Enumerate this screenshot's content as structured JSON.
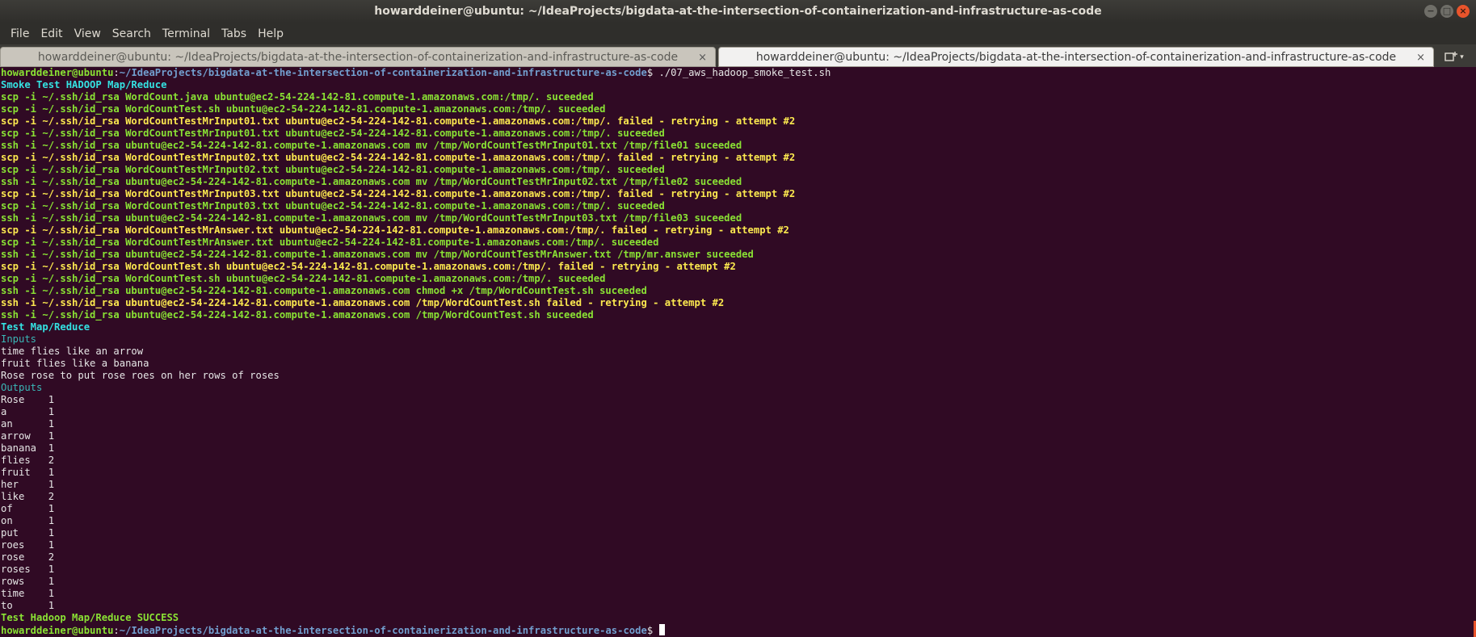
{
  "window": {
    "title": "howarddeiner@ubuntu: ~/IdeaProjects/bigdata-at-the-intersection-of-containerization-and-infrastructure-as-code",
    "buttons": {
      "minimize": "−",
      "maximize": "□",
      "close": "×"
    }
  },
  "menubar": {
    "items": [
      "File",
      "Edit",
      "View",
      "Search",
      "Terminal",
      "Tabs",
      "Help"
    ]
  },
  "tabs": [
    {
      "label": "howarddeiner@ubuntu: ~/IdeaProjects/bigdata-at-the-intersection-of-containerization-and-infrastructure-as-code",
      "close": "×",
      "active": false
    },
    {
      "label": "howarddeiner@ubuntu: ~/IdeaProjects/bigdata-at-the-intersection-of-containerization-and-infrastructure-as-code",
      "close": "×",
      "active": true
    }
  ],
  "new_tab_icon": "new-tab-icon",
  "terminal": {
    "prompt_user": "howarddeiner@ubuntu",
    "prompt_path": "~/IdeaProjects/bigdata-at-the-intersection-of-containerization-and-infrastructure-as-code",
    "command": " ./07_aws_hadoop_smoke_test.sh",
    "lines": [
      {
        "text": "Smoke Test HADOOP Map/Reduce",
        "color": "cyan"
      },
      {
        "text": "scp -i ~/.ssh/id_rsa WordCount.java ubuntu@ec2-54-224-142-81.compute-1.amazonaws.com:/tmp/. suceeded",
        "color": "green"
      },
      {
        "text": "scp -i ~/.ssh/id_rsa WordCountTest.sh ubuntu@ec2-54-224-142-81.compute-1.amazonaws.com:/tmp/. suceeded",
        "color": "green"
      },
      {
        "text": "scp -i ~/.ssh/id_rsa WordCountTestMrInput01.txt ubuntu@ec2-54-224-142-81.compute-1.amazonaws.com:/tmp/. failed - retrying - attempt #2",
        "color": "yellow"
      },
      {
        "text": "scp -i ~/.ssh/id_rsa WordCountTestMrInput01.txt ubuntu@ec2-54-224-142-81.compute-1.amazonaws.com:/tmp/. suceeded",
        "color": "green"
      },
      {
        "text": "ssh -i ~/.ssh/id_rsa ubuntu@ec2-54-224-142-81.compute-1.amazonaws.com mv /tmp/WordCountTestMrInput01.txt /tmp/file01 suceeded",
        "color": "green"
      },
      {
        "text": "scp -i ~/.ssh/id_rsa WordCountTestMrInput02.txt ubuntu@ec2-54-224-142-81.compute-1.amazonaws.com:/tmp/. failed - retrying - attempt #2",
        "color": "yellow"
      },
      {
        "text": "scp -i ~/.ssh/id_rsa WordCountTestMrInput02.txt ubuntu@ec2-54-224-142-81.compute-1.amazonaws.com:/tmp/. suceeded",
        "color": "green"
      },
      {
        "text": "ssh -i ~/.ssh/id_rsa ubuntu@ec2-54-224-142-81.compute-1.amazonaws.com mv /tmp/WordCountTestMrInput02.txt /tmp/file02 suceeded",
        "color": "green"
      },
      {
        "text": "scp -i ~/.ssh/id_rsa WordCountTestMrInput03.txt ubuntu@ec2-54-224-142-81.compute-1.amazonaws.com:/tmp/. failed - retrying - attempt #2",
        "color": "yellow"
      },
      {
        "text": "scp -i ~/.ssh/id_rsa WordCountTestMrInput03.txt ubuntu@ec2-54-224-142-81.compute-1.amazonaws.com:/tmp/. suceeded",
        "color": "green"
      },
      {
        "text": "ssh -i ~/.ssh/id_rsa ubuntu@ec2-54-224-142-81.compute-1.amazonaws.com mv /tmp/WordCountTestMrInput03.txt /tmp/file03 suceeded",
        "color": "green"
      },
      {
        "text": "scp -i ~/.ssh/id_rsa WordCountTestMrAnswer.txt ubuntu@ec2-54-224-142-81.compute-1.amazonaws.com:/tmp/. failed - retrying - attempt #2",
        "color": "yellow"
      },
      {
        "text": "scp -i ~/.ssh/id_rsa WordCountTestMrAnswer.txt ubuntu@ec2-54-224-142-81.compute-1.amazonaws.com:/tmp/. suceeded",
        "color": "green"
      },
      {
        "text": "ssh -i ~/.ssh/id_rsa ubuntu@ec2-54-224-142-81.compute-1.amazonaws.com mv /tmp/WordCountTestMrAnswer.txt /tmp/mr.answer suceeded",
        "color": "green"
      },
      {
        "text": "scp -i ~/.ssh/id_rsa WordCountTest.sh ubuntu@ec2-54-224-142-81.compute-1.amazonaws.com:/tmp/. failed - retrying - attempt #2",
        "color": "yellow"
      },
      {
        "text": "scp -i ~/.ssh/id_rsa WordCountTest.sh ubuntu@ec2-54-224-142-81.compute-1.amazonaws.com:/tmp/. suceeded",
        "color": "green"
      },
      {
        "text": "ssh -i ~/.ssh/id_rsa ubuntu@ec2-54-224-142-81.compute-1.amazonaws.com chmod +x /tmp/WordCountTest.sh suceeded",
        "color": "green"
      },
      {
        "text": "ssh -i ~/.ssh/id_rsa ubuntu@ec2-54-224-142-81.compute-1.amazonaws.com /tmp/WordCountTest.sh failed - retrying - attempt #2",
        "color": "yellow"
      },
      {
        "text": "ssh -i ~/.ssh/id_rsa ubuntu@ec2-54-224-142-81.compute-1.amazonaws.com /tmp/WordCountTest.sh suceeded",
        "color": "green"
      },
      {
        "text": "Test Map/Reduce",
        "color": "cyan"
      },
      {
        "text": "Inputs",
        "color": "teal"
      },
      {
        "text": "time flies like an arrow",
        "color": "white"
      },
      {
        "text": "fruit flies like a banana",
        "color": "white"
      },
      {
        "text": "Rose rose to put rose roes on her rows of roses",
        "color": "white"
      },
      {
        "text": "Outputs",
        "color": "teal"
      },
      {
        "text": "Rose    1",
        "color": "white"
      },
      {
        "text": "a       1",
        "color": "white"
      },
      {
        "text": "an      1",
        "color": "white"
      },
      {
        "text": "arrow   1",
        "color": "white"
      },
      {
        "text": "banana  1",
        "color": "white"
      },
      {
        "text": "flies   2",
        "color": "white"
      },
      {
        "text": "fruit   1",
        "color": "white"
      },
      {
        "text": "her     1",
        "color": "white"
      },
      {
        "text": "like    2",
        "color": "white"
      },
      {
        "text": "of      1",
        "color": "white"
      },
      {
        "text": "on      1",
        "color": "white"
      },
      {
        "text": "put     1",
        "color": "white"
      },
      {
        "text": "roes    1",
        "color": "white"
      },
      {
        "text": "rose    2",
        "color": "white"
      },
      {
        "text": "roses   1",
        "color": "white"
      },
      {
        "text": "rows    1",
        "color": "white"
      },
      {
        "text": "time    1",
        "color": "white"
      },
      {
        "text": "to      1",
        "color": "white"
      },
      {
        "text": "Test Hadoop Map/Reduce SUCCESS",
        "color": "green"
      }
    ],
    "final_prompt_suffix": "$ "
  },
  "colors": {
    "background": "#300a24",
    "green": "#8ae234",
    "yellow": "#fce94f",
    "cyan": "#34e2e2",
    "teal": "#3ab7b7",
    "white": "#e6e6e6",
    "path_blue": "#729fcf",
    "accent_orange": "#e9542b"
  }
}
